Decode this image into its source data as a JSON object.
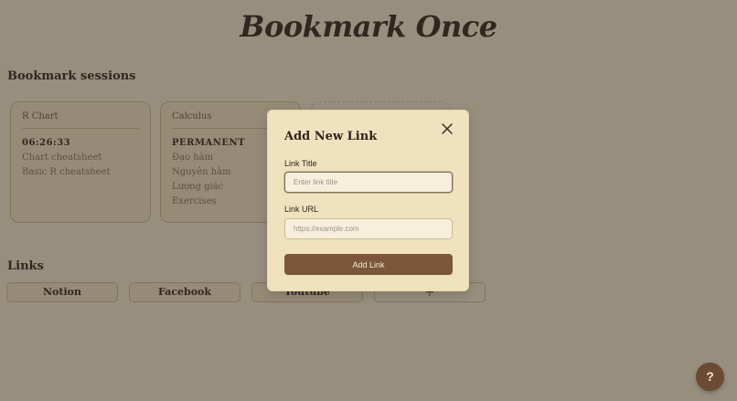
{
  "app": {
    "title": "Bookmark Once"
  },
  "sessions": {
    "heading": "Bookmark sessions",
    "cards": [
      {
        "name": "R Chart",
        "timer": "06:26:33",
        "links": [
          "Chart cheatsheet",
          "Basic R cheatsheet"
        ]
      },
      {
        "name": "Calculus",
        "timer": "PERMANENT",
        "links": [
          "Đạo hàm",
          "Nguyên hàm",
          "Lượng giác",
          "Exercises"
        ]
      }
    ]
  },
  "links": {
    "heading": "Links",
    "items": [
      "Notion",
      "Facebook",
      "Youtube"
    ],
    "add_label": "+"
  },
  "modal": {
    "title": "Add New Link",
    "title_label": "Link Title",
    "title_placeholder": "Enter link title",
    "url_label": "Link URL",
    "url_placeholder": "https://example.com",
    "submit_label": "Add Link"
  },
  "help": {
    "label": "?"
  },
  "colors": {
    "background": "#f2e6cc",
    "accent": "#7b563a",
    "modal_bg": "#f0e2bf",
    "help_bg": "#6b4b34"
  },
  "icons": {
    "close": "close-icon"
  }
}
